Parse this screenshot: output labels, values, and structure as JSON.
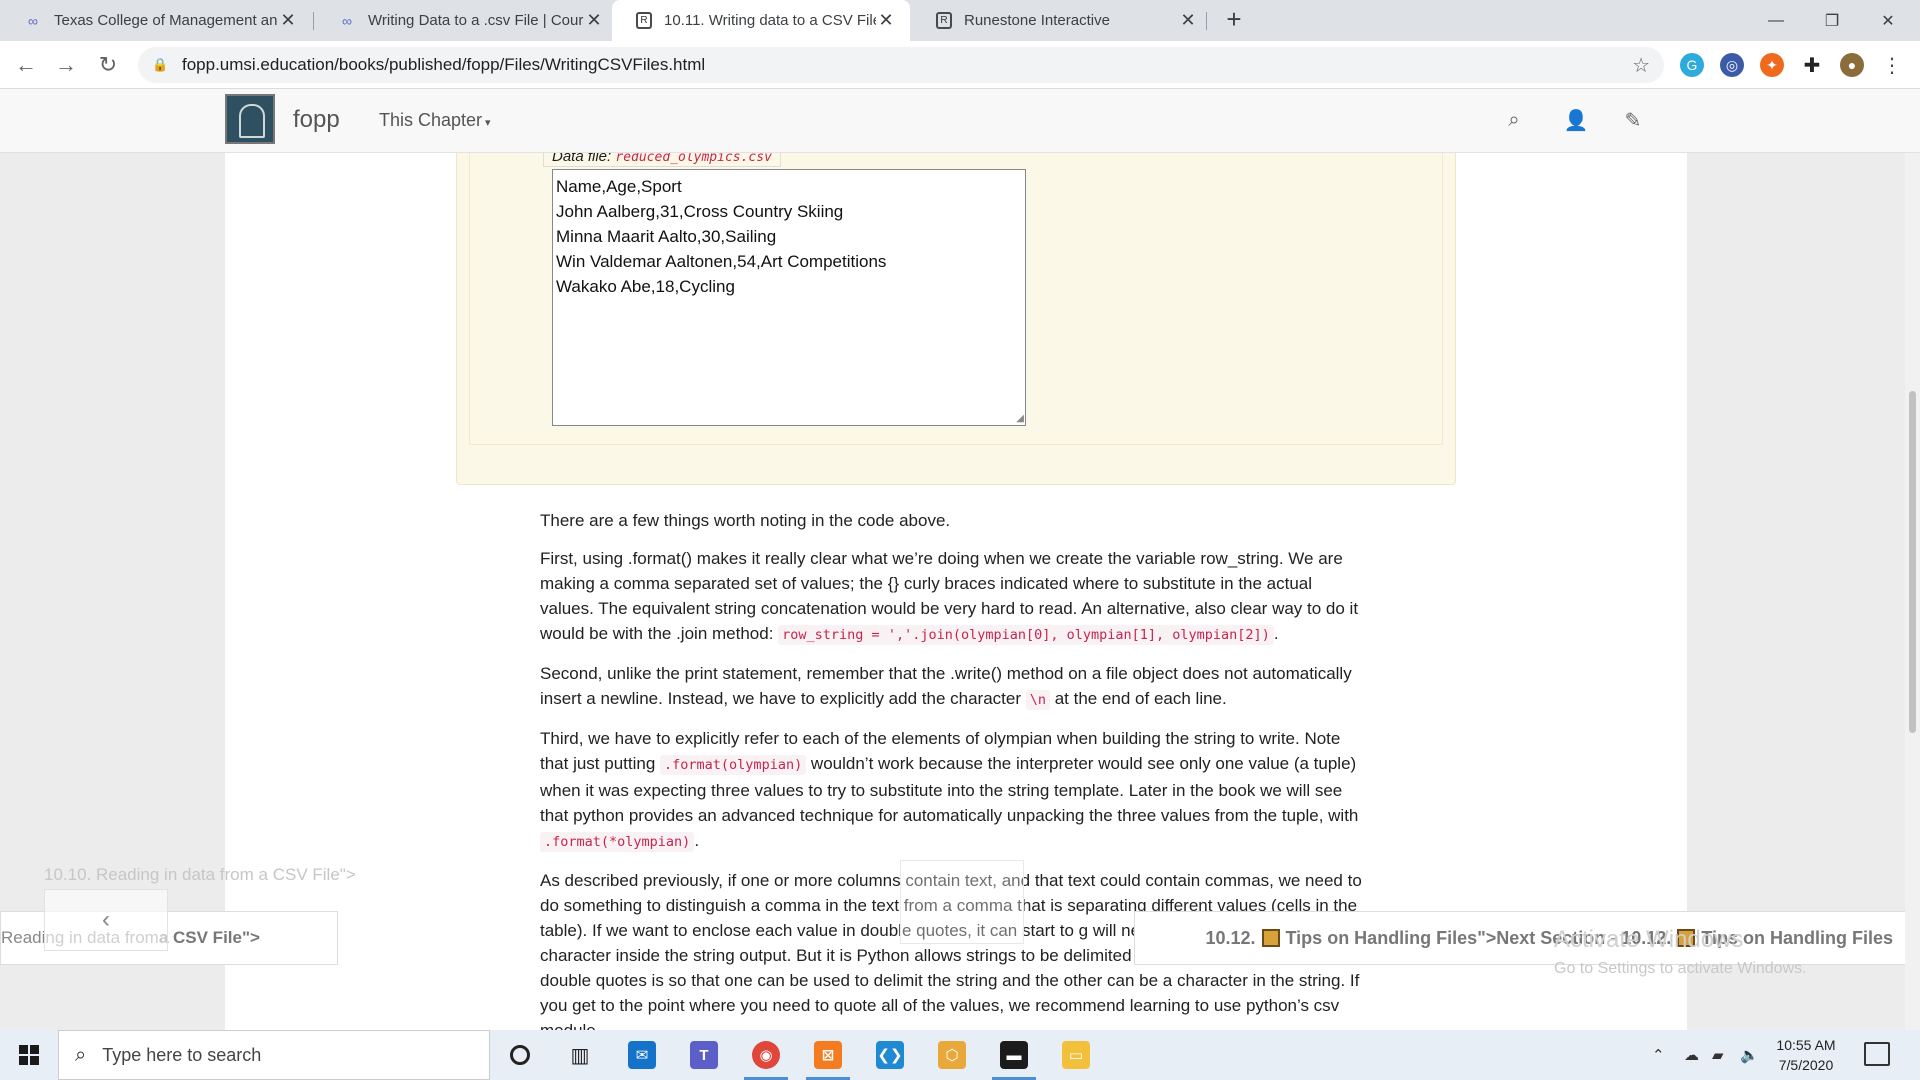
{
  "browser": {
    "tabs": [
      {
        "title": "Texas College of Management an",
        "favicon": "infinity-icon",
        "active": false
      },
      {
        "title": "Writing Data to a .csv File | Cours",
        "favicon": "infinity-icon",
        "active": false
      },
      {
        "title": "10.11. Writing data to a CSV File",
        "favicon": "doc-icon",
        "active": true
      },
      {
        "title": "Runestone Interactive",
        "favicon": "doc-icon",
        "active": false
      }
    ],
    "new_tab": "+",
    "url": "fopp.umsi.education/books/published/fopp/Files/WritingCSVFiles.html"
  },
  "site": {
    "brand": "fopp",
    "chapter_menu": "This Chapter"
  },
  "activecode": {
    "data_file_label": "Data file:",
    "data_file_name": "reduced_olympics.csv",
    "csv_lines": [
      "Name,Age,Sport",
      "John Aalberg,31,Cross Country Skiing",
      "Minna Maarit Aalto,30,Sailing",
      "Win Valdemar Aaltonen,54,Art Competitions",
      "Wakako Abe,18,Cycling"
    ]
  },
  "content": {
    "p1": "There are a few things worth noting in the code above.",
    "p2_a": "First, using .format() makes it really clear what we’re doing when we create the variable row_string. We are making a comma separated set of values; the {} curly braces indicated where to substitute in the actual values. The equivalent string concatenation would be very hard to read. An alternative, also clear way to do it would be with the .join method: ",
    "p2_code": "row_string = ','.join(olympian[0], olympian[1], olympian[2])",
    "p2_b": ".",
    "p3_a": "Second, unlike the print statement, remember that the .write() method on a file object does not automatically insert a newline. Instead, we have to explicitly add the character ",
    "p3_code": "\\n",
    "p3_b": " at the end of each line.",
    "p4_a": "Third, we have to explicitly refer to each of the elements of olympian when building the string to write. Note that just putting ",
    "p4_code1": ".format(olympian)",
    "p4_b": " wouldn’t work because the interpreter would see only one value (a tuple) when it was expecting three values to try to substitute into the string template. Later in the book we will see that python provides an advanced technique for automatically unpacking the three values from the tuple, with ",
    "p4_code2": ".format(*olympian)",
    "p4_c": ".",
    "p5": "As described previously, if one or more columns contain text, and that text could contain commas, we need to do something to distinguish a comma in the text from a comma that is separating different values (cells in the table). If we want to enclose each value in double quotes, it can start to g will need to have the double quote character inside the string output. But it is Python allows strings to be delimited with either single quotes or double quotes is so that one can be used to delimit the string and the other can be a character in the string. If you get to the point where you need to quote all of the values, we recommend learning to use python’s csv module."
  },
  "nav": {
    "prev_ghost": "10.10. Reading in data from a CSV File\">",
    "prev_button_a": "Reading in data from ",
    "prev_button_b": "a CSV File\">",
    "next_button_a": "10.12. ",
    "next_button_b": " Tips on Handling Files\">Next Section - 10.12. ",
    "next_button_c": " Tips on Handling Files"
  },
  "watermark": {
    "line1": "Activate Windows",
    "line2": "Go to Settings to activate Windows."
  },
  "taskbar": {
    "search_placeholder": "Type here to search",
    "time": "10:55 AM",
    "date": "7/5/2020"
  },
  "colors": {
    "accent_blue": "#4a90d9",
    "code_red": "#c7254e",
    "activecode_bg": "#fcf8e8"
  }
}
